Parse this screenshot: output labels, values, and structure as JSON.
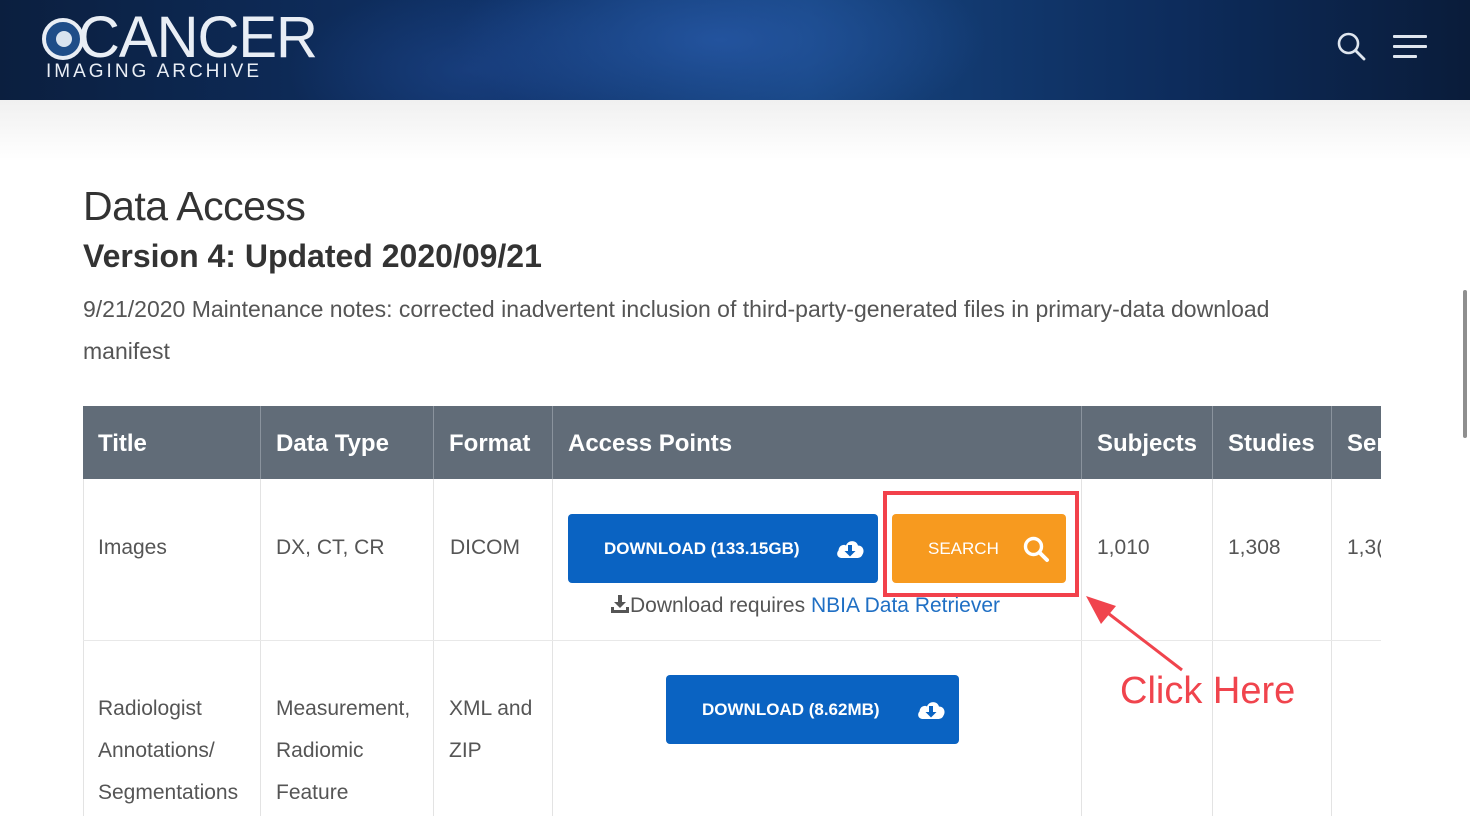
{
  "header": {
    "logo_main": "CANCER",
    "logo_sub": "IMAGING ARCHIVE",
    "search_icon": "search-icon",
    "menu_icon": "hamburger-menu-icon"
  },
  "section": {
    "title": "Data Access",
    "version": "Version 4: Updated 2020/09/21",
    "notes": "9/21/2020 Maintenance notes: corrected inadvertent inclusion of third-party-generated files in primary-data download manifest"
  },
  "table": {
    "headers": [
      "Title",
      "Data Type",
      "Format",
      "Access Points",
      "Subjects",
      "Studies",
      "Ser"
    ],
    "rows": [
      {
        "title": "Images",
        "data_type": "DX, CT, CR",
        "format": "DICOM",
        "download_label": "DOWNLOAD (133.15GB)",
        "search_label": "SEARCH",
        "requires_text": "Download requires ",
        "requires_link": "NBIA Data Retriever",
        "subjects": "1,010",
        "studies": "1,308",
        "series": "1,3("
      },
      {
        "title_lines": [
          "Radiologist",
          "Annotations/",
          "Segmentations"
        ],
        "data_type_lines": [
          "Measurement,",
          "Radiomic",
          "Feature"
        ],
        "format_lines": [
          "XML and",
          "ZIP"
        ],
        "download_label": "DOWNLOAD (8.62MB)"
      }
    ]
  },
  "annotation": {
    "label": "Click Here",
    "color": "#f0444d"
  },
  "colors": {
    "header_bg": "#0f3268",
    "table_header_bg": "#616c78",
    "download_button": "#0a63c2",
    "search_button": "#f79a1f",
    "link": "#1f6fc4"
  }
}
